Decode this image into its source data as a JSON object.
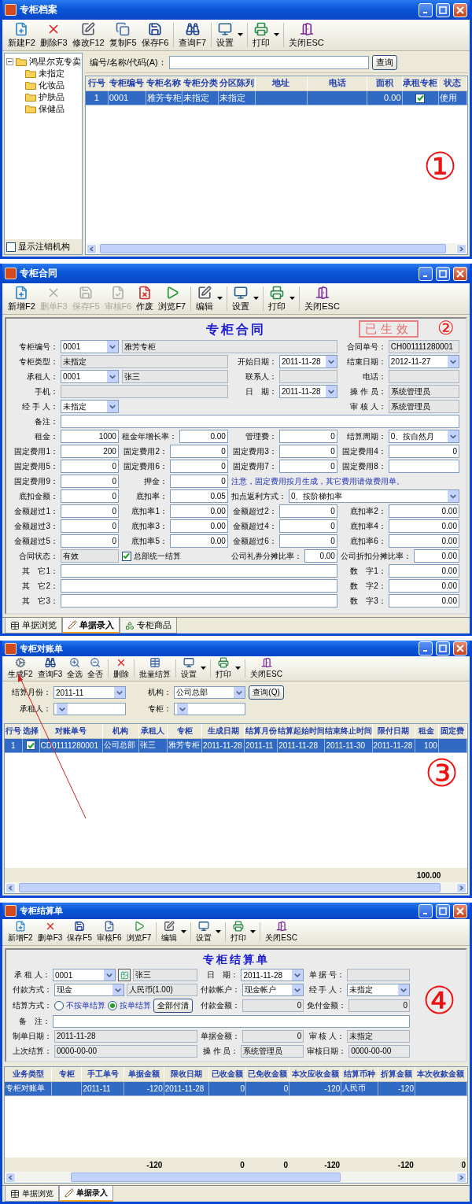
{
  "windows": [
    {
      "kind": "archive",
      "title": "专柜档案",
      "annotation": "①",
      "toolbar": [
        [
          {
            "kind": "new",
            "label": "新建F2",
            "disabled": false,
            "dropdown": false
          },
          {
            "kind": "delete",
            "label": "删除F3",
            "disabled": false,
            "dropdown": false
          },
          {
            "kind": "edit",
            "label": "修改F12",
            "disabled": false,
            "dropdown": false
          },
          {
            "kind": "copy",
            "label": "复制F5",
            "disabled": false,
            "dropdown": false
          },
          {
            "kind": "save",
            "label": "保存F6",
            "disabled": false,
            "dropdown": false
          }
        ],
        [
          {
            "kind": "find",
            "label": "查询F7",
            "disabled": false,
            "dropdown": false
          }
        ],
        [
          {
            "kind": "settings",
            "label": "设置",
            "disabled": false,
            "dropdown": true
          }
        ],
        [
          {
            "kind": "print",
            "label": "打印",
            "disabled": false,
            "dropdown": true
          }
        ],
        [
          {
            "kind": "close",
            "label": "关闭ESC",
            "disabled": false,
            "dropdown": false
          }
        ]
      ],
      "tree": {
        "label": "鸿星尔克专卖",
        "expanded": true,
        "children": [
          {
            "label": "未指定"
          },
          {
            "label": "化妆品"
          },
          {
            "label": "护肤品"
          },
          {
            "label": "保健品"
          }
        ]
      },
      "show_cancelled": {
        "label": "显示注销机构",
        "checked": false
      },
      "search": {
        "rows": [
          [
            {
              "label": "编号/名称/代码(A)：",
              "controls": [
                {
                  "kind": "input"
                }
              ]
            },
            {
              "controls": [
                {
                  "kind": "button",
                  "label": "查询"
                }
              ]
            }
          ]
        ]
      },
      "grid": {
        "columns": [
          {
            "label": "行号",
            "kind": "index"
          },
          {
            "label": "专柜编号",
            "kind": "text"
          },
          {
            "label": "专柜名称",
            "kind": "text"
          },
          {
            "label": "专柜分类",
            "kind": "text"
          },
          {
            "label": "分区陈列",
            "kind": "text"
          },
          {
            "label": "地址",
            "kind": "text"
          },
          {
            "label": "电话",
            "kind": "text"
          },
          {
            "label": "面积",
            "kind": "number"
          },
          {
            "label": "承租专柜",
            "kind": "check"
          },
          {
            "label": "状态",
            "kind": "text"
          }
        ],
        "rows": [
          {
            "selected": true,
            "cells": {
              "c0": "1",
              "c1": "0001",
              "c2": "雅芳专柜",
              "c3": "未指定",
              "c4": "未指定",
              "c7": "0.00",
              "c8": true,
              "c9": "使用"
            }
          }
        ]
      }
    },
    {
      "kind": "contract",
      "title": "专柜合同",
      "annotation": "②",
      "form_title": "专柜合同",
      "stamp": "已生效",
      "toolbar": [
        [
          {
            "kind": "new",
            "label": "新增F2",
            "disabled": false,
            "dropdown": false
          },
          {
            "kind": "delete",
            "label": "删单F3",
            "disabled": true,
            "dropdown": false
          },
          {
            "kind": "save",
            "label": "保存F5",
            "disabled": true,
            "dropdown": false
          },
          {
            "kind": "audit",
            "label": "审核F6",
            "disabled": true,
            "dropdown": false
          },
          {
            "kind": "void",
            "label": "作废",
            "disabled": false,
            "dropdown": false
          },
          {
            "kind": "browse",
            "label": "浏览F7",
            "disabled": false,
            "dropdown": false
          }
        ],
        [
          {
            "kind": "edit",
            "label": "编辑",
            "disabled": false,
            "dropdown": true
          }
        ],
        [
          {
            "kind": "settings",
            "label": "设置",
            "disabled": false,
            "dropdown": true
          }
        ],
        [
          {
            "kind": "print",
            "label": "打印",
            "disabled": false,
            "dropdown": true
          }
        ],
        [
          {
            "kind": "close",
            "label": "关闭ESC",
            "disabled": false,
            "dropdown": false
          }
        ]
      ],
      "form": {
        "rows": [
          [
            {
              "label": "专柜编号：",
              "controls": [
                {
                  "kind": "combo",
                  "value": "0001"
                }
              ]
            },
            {
              "controls": [
                {
                  "kind": "readonly",
                  "value": "雅芳专柜"
                }
              ]
            },
            {
              "label": "合同单号：",
              "controls": [
                {
                  "kind": "readonly",
                  "value": "CH001111280001"
                }
              ]
            }
          ],
          [
            {
              "label": "专柜类型：",
              "controls": [
                {
                  "kind": "readonly",
                  "value": "未指定"
                }
              ]
            },
            {
              "label": "开始日期：",
              "controls": [
                {
                  "kind": "combo",
                  "value": "2011-11-28"
                }
              ]
            },
            {
              "label": "结束日期：",
              "controls": [
                {
                  "kind": "combo",
                  "value": "2012-11-27"
                }
              ]
            }
          ],
          [
            {
              "label": "承租人：",
              "controls": [
                {
                  "kind": "combo",
                  "value": "0001"
                }
              ]
            },
            {
              "controls": [
                {
                  "kind": "readonly",
                  "value": "张三"
                }
              ]
            },
            {
              "label": "联系人：",
              "controls": [
                {
                  "kind": "readonly"
                }
              ]
            },
            {
              "label": "电话：",
              "controls": [
                {
                  "kind": "readonly"
                }
              ]
            }
          ],
          [
            {
              "label": "手机：",
              "controls": [
                {
                  "kind": "readonly"
                }
              ]
            },
            {
              "label": "日　期：",
              "controls": [
                {
                  "kind": "combo",
                  "value": "2011-11-28"
                }
              ]
            },
            {
              "label": "操 作 员：",
              "controls": [
                {
                  "kind": "readonly",
                  "value": "系统管理员"
                }
              ]
            }
          ],
          [
            {
              "label": "经 手 人：",
              "controls": [
                {
                  "kind": "combo",
                  "value": "未指定"
                }
              ]
            },
            {
              "controls": [
                {
                  "kind": "blank"
                }
              ]
            },
            {
              "label": "审 核 人：",
              "controls": [
                {
                  "kind": "readonly",
                  "value": "系统管理员"
                }
              ]
            }
          ],
          [
            {
              "label": "备注：",
              "controls": [
                {
                  "kind": "input"
                }
              ]
            }
          ],
          [
            {
              "label": "租金：",
              "controls": [
                {
                  "kind": "number",
                  "value": "1000"
                }
              ]
            },
            {
              "label": "租金年增长率：",
              "controls": [
                {
                  "kind": "number",
                  "value": "0.00"
                }
              ]
            },
            {
              "label": "管理费：",
              "controls": [
                {
                  "kind": "number",
                  "value": "0"
                }
              ]
            },
            {
              "label": "结算周期：",
              "controls": [
                {
                  "kind": "combo",
                  "value": "0、按自然月"
                }
              ]
            }
          ],
          [
            {
              "label": "固定费用1：",
              "controls": [
                {
                  "kind": "number",
                  "value": "200"
                }
              ]
            },
            {
              "label": "固定费用2：",
              "controls": [
                {
                  "kind": "number",
                  "value": "0"
                }
              ]
            },
            {
              "label": "固定费用3：",
              "controls": [
                {
                  "kind": "number",
                  "value": "0"
                }
              ]
            },
            {
              "label": "固定费用4：",
              "controls": [
                {
                  "kind": "number",
                  "value": "0"
                }
              ]
            }
          ],
          [
            {
              "label": "固定费用5：",
              "controls": [
                {
                  "kind": "number",
                  "value": "0"
                }
              ]
            },
            {
              "label": "固定费用6：",
              "controls": [
                {
                  "kind": "number",
                  "value": "0"
                }
              ]
            },
            {
              "label": "固定费用7：",
              "controls": [
                {
                  "kind": "number",
                  "value": "0"
                }
              ]
            },
            {
              "label": "固定费用8：",
              "controls": [
                {
                  "kind": "number"
                }
              ]
            }
          ],
          [
            {
              "label": "固定费用9：",
              "controls": [
                {
                  "kind": "number",
                  "value": "0"
                }
              ]
            },
            {
              "label": "押金：",
              "controls": [
                {
                  "kind": "number",
                  "value": "0"
                }
              ]
            },
            {
              "controls": [
                {
                  "kind": "note",
                  "value": "注意，固定费用按月生成，其它费用请做费用单。"
                }
              ]
            }
          ],
          [
            {
              "label": "底扣金额：",
              "controls": [
                {
                  "kind": "number",
                  "value": "0"
                }
              ]
            },
            {
              "label": "底扣率：",
              "controls": [
                {
                  "kind": "number",
                  "value": "0.05"
                }
              ]
            },
            {
              "label": "扣点返利方式：",
              "controls": [
                {
                  "kind": "combo",
                  "value": "0、按阶梯扣率"
                }
              ]
            }
          ],
          [
            {
              "label": "金额超过1：",
              "controls": [
                {
                  "kind": "number",
                  "value": "0"
                }
              ]
            },
            {
              "label": "底扣率1：",
              "controls": [
                {
                  "kind": "number",
                  "value": "0.00"
                }
              ]
            },
            {
              "label": "金额超过2：",
              "controls": [
                {
                  "kind": "number",
                  "value": "0"
                }
              ]
            },
            {
              "label": "底扣率2：",
              "controls": [
                {
                  "kind": "number",
                  "value": "0.00"
                }
              ]
            }
          ],
          [
            {
              "label": "金额超过3：",
              "controls": [
                {
                  "kind": "number",
                  "value": "0"
                }
              ]
            },
            {
              "label": "底扣率3：",
              "controls": [
                {
                  "kind": "number",
                  "value": "0.00"
                }
              ]
            },
            {
              "label": "金额超过4：",
              "controls": [
                {
                  "kind": "number",
                  "value": "0"
                }
              ]
            },
            {
              "label": "底扣率4：",
              "controls": [
                {
                  "kind": "number",
                  "value": "0.00"
                }
              ]
            }
          ],
          [
            {
              "label": "金额超过5：",
              "controls": [
                {
                  "kind": "number",
                  "value": "0"
                }
              ]
            },
            {
              "label": "底扣率5：",
              "controls": [
                {
                  "kind": "number",
                  "value": "0.00"
                }
              ]
            },
            {
              "label": "金额超过6：",
              "controls": [
                {
                  "kind": "number",
                  "value": "0"
                }
              ]
            },
            {
              "label": "底扣率6：",
              "controls": [
                {
                  "kind": "number",
                  "value": "0.00"
                }
              ]
            }
          ],
          [
            {
              "label": "合同状态：",
              "controls": [
                {
                  "kind": "readonly",
                  "value": "有效"
                }
              ]
            },
            {
              "controls": [
                {
                  "kind": "check",
                  "label": "总部统一结算",
                  "checked": true
                }
              ]
            },
            {
              "label": "公司礼券分摊比率：",
              "controls": [
                {
                  "kind": "number",
                  "value": "0.00"
                }
              ]
            },
            {
              "label": "公司折扣分摊比率：",
              "controls": [
                {
                  "kind": "number",
                  "value": "0.00"
                }
              ]
            }
          ],
          [
            {
              "label": "其　它1：",
              "controls": [
                {
                  "kind": "input"
                }
              ]
            },
            {
              "label": "数　字1：",
              "controls": [
                {
                  "kind": "number",
                  "value": "0.00"
                }
              ]
            }
          ],
          [
            {
              "label": "其　它2：",
              "controls": [
                {
                  "kind": "input"
                }
              ]
            },
            {
              "label": "数　字2：",
              "controls": [
                {
                  "kind": "number",
                  "value": "0.00"
                }
              ]
            }
          ],
          [
            {
              "label": "其　它3：",
              "controls": [
                {
                  "kind": "input"
                }
              ]
            },
            {
              "label": "数　字3：",
              "controls": [
                {
                  "kind": "number",
                  "value": "0.00"
                }
              ]
            }
          ]
        ]
      },
      "tabs": [
        {
          "kind": "list",
          "label": "单据浏览",
          "selected": false
        },
        {
          "kind": "entry",
          "label": "单据录入",
          "selected": true
        },
        {
          "kind": "goods",
          "label": "专柜商品",
          "selected": false
        }
      ]
    },
    {
      "kind": "reconcile",
      "title": "专柜对账单",
      "annotation": "③",
      "toolbar": [
        [
          {
            "kind": "generate",
            "label": "生成F2",
            "disabled": false,
            "dropdown": false
          },
          {
            "kind": "find",
            "label": "查询F3",
            "disabled": false,
            "dropdown": false
          },
          {
            "kind": "select-all",
            "label": "全选",
            "disabled": false,
            "dropdown": false
          },
          {
            "kind": "select-none",
            "label": "全否",
            "disabled": false,
            "dropdown": false
          }
        ],
        [
          {
            "kind": "delete",
            "label": "删除",
            "disabled": false,
            "dropdown": false
          }
        ],
        [
          {
            "kind": "batch",
            "label": "批量结算",
            "disabled": false,
            "dropdown": false
          }
        ],
        [
          {
            "kind": "settings",
            "label": "设置",
            "disabled": false,
            "dropdown": true
          }
        ],
        [
          {
            "kind": "print",
            "label": "打印",
            "disabled": false,
            "dropdown": true
          }
        ],
        [
          {
            "kind": "close",
            "label": "关闭ESC",
            "disabled": false,
            "dropdown": false
          }
        ]
      ],
      "filter": {
        "rows": [
          [
            {
              "label": "结算月份：",
              "controls": [
                {
                  "kind": "combo",
                  "value": "2011-11"
                }
              ]
            },
            {
              "label": "机构：",
              "controls": [
                {
                  "kind": "combo",
                  "value": "公司总部"
                }
              ]
            },
            {
              "controls": [
                {
                  "kind": "button",
                  "label": "查询(Q)"
                }
              ]
            }
          ],
          [
            {
              "label": "承租人：",
              "controls": [
                {
                  "kind": "combo"
                }
              ]
            },
            {
              "label": "专柜：",
              "controls": [
                {
                  "kind": "combo"
                }
              ]
            }
          ]
        ]
      },
      "grid": {
        "columns": [
          {
            "label": "行号",
            "kind": "index"
          },
          {
            "label": "选择",
            "kind": "check"
          },
          {
            "label": "对账单号",
            "kind": "text"
          },
          {
            "label": "机构",
            "kind": "text"
          },
          {
            "label": "承租人",
            "kind": "text"
          },
          {
            "label": "专柜",
            "kind": "text"
          },
          {
            "label": "生成日期",
            "kind": "text"
          },
          {
            "label": "结算月份",
            "kind": "text"
          },
          {
            "label": "结算起始时间",
            "kind": "text"
          },
          {
            "label": "结束终止时间",
            "kind": "text"
          },
          {
            "label": "限付日期",
            "kind": "text"
          },
          {
            "label": "租金",
            "kind": "number"
          },
          {
            "label": "固定费",
            "kind": "number"
          }
        ],
        "rows": [
          {
            "selected": true,
            "cells": {
              "c0": "1",
              "c1": true,
              "c2": "CD01111280001",
              "c3": "公司总部",
              "c4": "张三",
              "c5": "雅芳专柜",
              "c6": "2011-11-28",
              "c7": "2011-11",
              "c8": "2011-11-28",
              "c9": "2011-11-30",
              "c10": "2011-11-28",
              "c11": "100"
            }
          }
        ],
        "footer": {
          "c11": "100.00"
        }
      }
    },
    {
      "kind": "settlement",
      "title": "专柜结算单",
      "annotation": "④",
      "form_title": "专柜结算单",
      "toolbar": [
        [
          {
            "kind": "new",
            "label": "新增F2",
            "disabled": false,
            "dropdown": false
          },
          {
            "kind": "delete",
            "label": "删单F3",
            "disabled": false,
            "dropdown": false
          },
          {
            "kind": "save",
            "label": "保存F5",
            "disabled": false,
            "dropdown": false
          },
          {
            "kind": "audit",
            "label": "审核F6",
            "disabled": false,
            "dropdown": false
          },
          {
            "kind": "browse",
            "label": "浏览F7",
            "disabled": false,
            "dropdown": false
          }
        ],
        [
          {
            "kind": "edit",
            "label": "编辑",
            "disabled": false,
            "dropdown": true
          }
        ],
        [
          {
            "kind": "settings",
            "label": "设置",
            "disabled": false,
            "dropdown": true
          }
        ],
        [
          {
            "kind": "print",
            "label": "打印",
            "disabled": false,
            "dropdown": true
          }
        ],
        [
          {
            "kind": "close",
            "label": "关闭ESC",
            "disabled": false,
            "dropdown": false
          }
        ]
      ],
      "form": {
        "rows": [
          [
            {
              "label": "承 租 人：",
              "controls": [
                {
                  "kind": "combo",
                  "value": "0001"
                },
                {
                  "kind": "picker"
                },
                {
                  "kind": "readonly",
                  "value": "张三"
                }
              ]
            },
            {
              "label": "日　期：",
              "controls": [
                {
                  "kind": "combo",
                  "value": "2011-11-28"
                }
              ]
            },
            {
              "label": "单 据 号：",
              "controls": [
                {
                  "kind": "readonly"
                }
              ]
            }
          ],
          [
            {
              "label": "付款方式：",
              "controls": [
                {
                  "kind": "combo",
                  "value": "现金"
                },
                {
                  "kind": "readonly",
                  "value": "人民币(1.00)"
                }
              ]
            },
            {
              "label": "付款帐户：",
              "controls": [
                {
                  "kind": "combo",
                  "value": "现金帐户"
                }
              ]
            },
            {
              "label": "经 手 人：",
              "controls": [
                {
                  "kind": "combo",
                  "value": "未指定"
                }
              ]
            }
          ],
          [
            {
              "label": "结算方式：",
              "controls": [
                {
                  "kind": "radio",
                  "label": "不按单结算",
                  "selected": false
                },
                {
                  "kind": "radio",
                  "label": "按单结算",
                  "selected": true
                },
                {
                  "kind": "button",
                  "label": "全部付清"
                }
              ]
            },
            {
              "label": "付款金额：",
              "controls": [
                {
                  "kind": "readonly-number",
                  "value": "0"
                }
              ]
            },
            {
              "label": "免付金额：",
              "controls": [
                {
                  "kind": "readonly-number",
                  "value": "0"
                }
              ]
            }
          ],
          [
            {
              "label": "备　注：",
              "controls": [
                {
                  "kind": "input"
                }
              ]
            }
          ],
          [
            {
              "label": "制单日期：",
              "controls": [
                {
                  "kind": "readonly",
                  "value": "2011-11-28"
                }
              ]
            },
            {
              "label": "单据金额：",
              "controls": [
                {
                  "kind": "readonly-number",
                  "value": "0"
                }
              ]
            },
            {
              "label": "审 核 人：",
              "controls": [
                {
                  "kind": "readonly",
                  "value": "未指定"
                }
              ]
            }
          ],
          [
            {
              "label": "上次结算：",
              "controls": [
                {
                  "kind": "readonly",
                  "value": "0000-00-00"
                }
              ]
            },
            {
              "label": "操 作 员：",
              "controls": [
                {
                  "kind": "readonly",
                  "value": "系统管理员"
                }
              ]
            },
            {
              "label": "审核日期：",
              "controls": [
                {
                  "kind": "readonly",
                  "value": "0000-00-00"
                }
              ]
            }
          ]
        ]
      },
      "grid": {
        "columns": [
          {
            "label": "业务类型",
            "kind": "text"
          },
          {
            "label": "专柜",
            "kind": "text"
          },
          {
            "label": "手工单号",
            "kind": "text"
          },
          {
            "label": "单据金额",
            "kind": "number"
          },
          {
            "label": "限收日期",
            "kind": "text"
          },
          {
            "label": "已收金额",
            "kind": "number"
          },
          {
            "label": "已免收金额",
            "kind": "number"
          },
          {
            "label": "本次应收金额",
            "kind": "number"
          },
          {
            "label": "结算币种",
            "kind": "text"
          },
          {
            "label": "折算金额",
            "kind": "number"
          },
          {
            "label": "本次收款金额",
            "kind": "number"
          }
        ],
        "rows": [
          {
            "selected": true,
            "cells": {
              "c0": "专柜对账单",
              "c2": "2011-11",
              "c3": "-120",
              "c4": "2011-11-28",
              "c5": "0",
              "c6": "0",
              "c7": "-120",
              "c8": "人民币",
              "c9": "-120"
            }
          }
        ],
        "footer": {
          "c3": "-120",
          "c5": "0",
          "c6": "0",
          "c7": "-120",
          "c9": "-120",
          "c10": "0"
        }
      },
      "tabs": [
        {
          "kind": "list",
          "label": "单据浏览",
          "selected": false
        },
        {
          "kind": "entry",
          "label": "单据录入",
          "selected": true
        }
      ]
    }
  ]
}
